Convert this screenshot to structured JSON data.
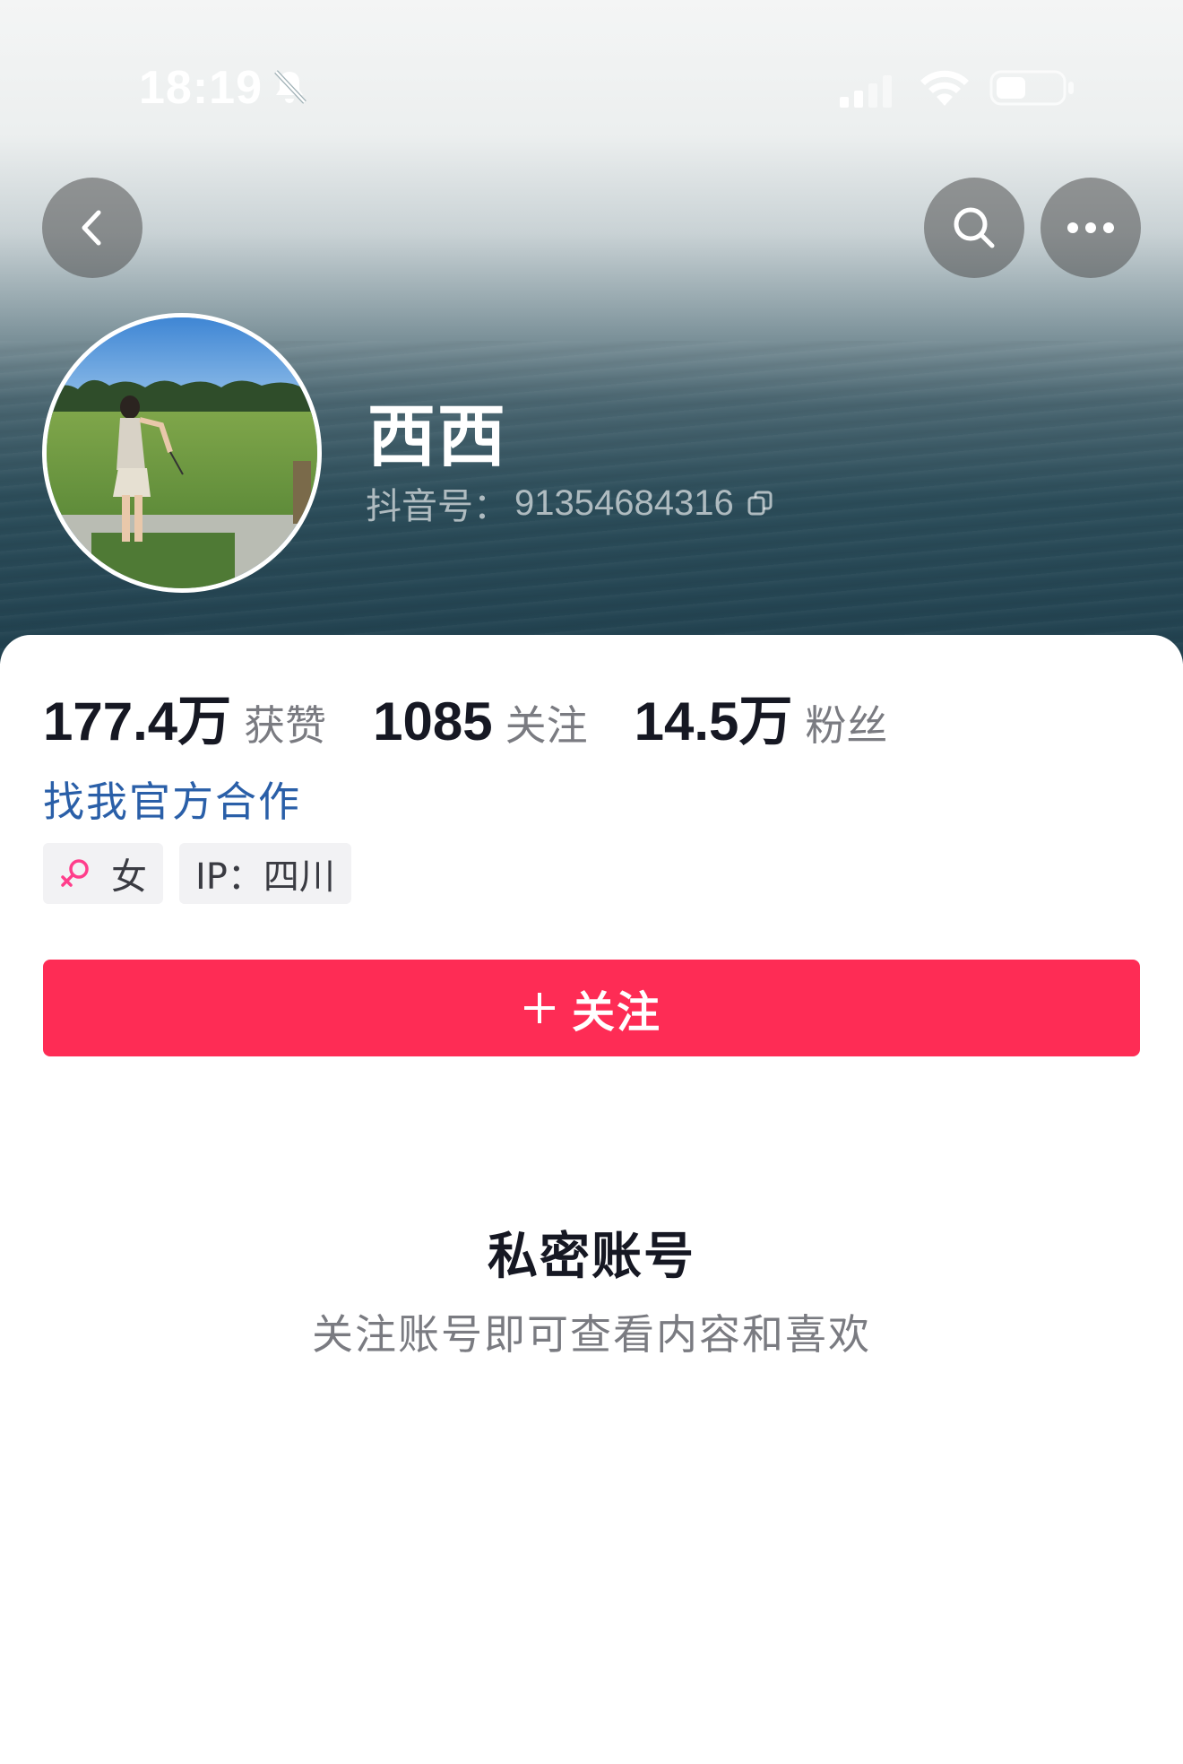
{
  "status_bar": {
    "time": "18:19",
    "icons": [
      "bell-slash-icon",
      "cellular-signal-icon",
      "wifi-icon",
      "battery-icon"
    ]
  },
  "nav": {
    "back_icon": "chevron-left-icon",
    "search_icon": "search-icon",
    "more_icon": "more-horizontal-icon"
  },
  "profile": {
    "name": "西西",
    "id_label": "抖音号：",
    "id_value": "91354684316",
    "avatar_description": "golf-range-avatar"
  },
  "stats": [
    {
      "value": "177.4万",
      "label": "获赞"
    },
    {
      "value": "1085",
      "label": "关注"
    },
    {
      "value": "14.5万",
      "label": "粉丝"
    }
  ],
  "cooperation_link": "找我官方合作",
  "tags": {
    "gender": "女",
    "ip": "IP：四川"
  },
  "follow_button": {
    "label": "关注"
  },
  "private_notice": {
    "title": "私密账号",
    "subtitle": "关注账号即可查看内容和喜欢"
  },
  "colors": {
    "accent": "#fe2c55",
    "link": "#2a5fa8",
    "female": "#ff3e8b"
  }
}
